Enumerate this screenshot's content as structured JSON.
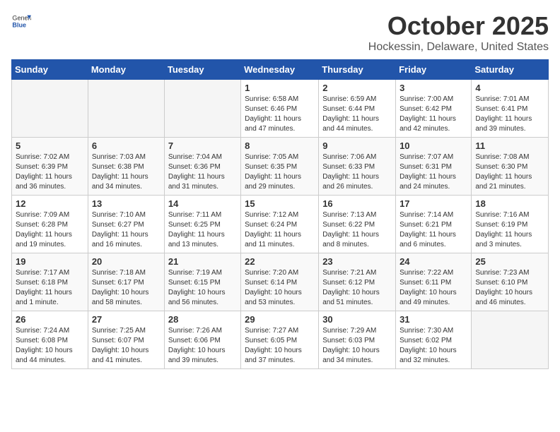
{
  "header": {
    "logo_general": "General",
    "logo_blue": "Blue",
    "month": "October 2025",
    "location": "Hockessin, Delaware, United States"
  },
  "days_of_week": [
    "Sunday",
    "Monday",
    "Tuesday",
    "Wednesday",
    "Thursday",
    "Friday",
    "Saturday"
  ],
  "weeks": [
    [
      {
        "day": "",
        "info": ""
      },
      {
        "day": "",
        "info": ""
      },
      {
        "day": "",
        "info": ""
      },
      {
        "day": "1",
        "info": "Sunrise: 6:58 AM\nSunset: 6:46 PM\nDaylight: 11 hours\nand 47 minutes."
      },
      {
        "day": "2",
        "info": "Sunrise: 6:59 AM\nSunset: 6:44 PM\nDaylight: 11 hours\nand 44 minutes."
      },
      {
        "day": "3",
        "info": "Sunrise: 7:00 AM\nSunset: 6:42 PM\nDaylight: 11 hours\nand 42 minutes."
      },
      {
        "day": "4",
        "info": "Sunrise: 7:01 AM\nSunset: 6:41 PM\nDaylight: 11 hours\nand 39 minutes."
      }
    ],
    [
      {
        "day": "5",
        "info": "Sunrise: 7:02 AM\nSunset: 6:39 PM\nDaylight: 11 hours\nand 36 minutes."
      },
      {
        "day": "6",
        "info": "Sunrise: 7:03 AM\nSunset: 6:38 PM\nDaylight: 11 hours\nand 34 minutes."
      },
      {
        "day": "7",
        "info": "Sunrise: 7:04 AM\nSunset: 6:36 PM\nDaylight: 11 hours\nand 31 minutes."
      },
      {
        "day": "8",
        "info": "Sunrise: 7:05 AM\nSunset: 6:35 PM\nDaylight: 11 hours\nand 29 minutes."
      },
      {
        "day": "9",
        "info": "Sunrise: 7:06 AM\nSunset: 6:33 PM\nDaylight: 11 hours\nand 26 minutes."
      },
      {
        "day": "10",
        "info": "Sunrise: 7:07 AM\nSunset: 6:31 PM\nDaylight: 11 hours\nand 24 minutes."
      },
      {
        "day": "11",
        "info": "Sunrise: 7:08 AM\nSunset: 6:30 PM\nDaylight: 11 hours\nand 21 minutes."
      }
    ],
    [
      {
        "day": "12",
        "info": "Sunrise: 7:09 AM\nSunset: 6:28 PM\nDaylight: 11 hours\nand 19 minutes."
      },
      {
        "day": "13",
        "info": "Sunrise: 7:10 AM\nSunset: 6:27 PM\nDaylight: 11 hours\nand 16 minutes."
      },
      {
        "day": "14",
        "info": "Sunrise: 7:11 AM\nSunset: 6:25 PM\nDaylight: 11 hours\nand 13 minutes."
      },
      {
        "day": "15",
        "info": "Sunrise: 7:12 AM\nSunset: 6:24 PM\nDaylight: 11 hours\nand 11 minutes."
      },
      {
        "day": "16",
        "info": "Sunrise: 7:13 AM\nSunset: 6:22 PM\nDaylight: 11 hours\nand 8 minutes."
      },
      {
        "day": "17",
        "info": "Sunrise: 7:14 AM\nSunset: 6:21 PM\nDaylight: 11 hours\nand 6 minutes."
      },
      {
        "day": "18",
        "info": "Sunrise: 7:16 AM\nSunset: 6:19 PM\nDaylight: 11 hours\nand 3 minutes."
      }
    ],
    [
      {
        "day": "19",
        "info": "Sunrise: 7:17 AM\nSunset: 6:18 PM\nDaylight: 11 hours\nand 1 minute."
      },
      {
        "day": "20",
        "info": "Sunrise: 7:18 AM\nSunset: 6:17 PM\nDaylight: 10 hours\nand 58 minutes."
      },
      {
        "day": "21",
        "info": "Sunrise: 7:19 AM\nSunset: 6:15 PM\nDaylight: 10 hours\nand 56 minutes."
      },
      {
        "day": "22",
        "info": "Sunrise: 7:20 AM\nSunset: 6:14 PM\nDaylight: 10 hours\nand 53 minutes."
      },
      {
        "day": "23",
        "info": "Sunrise: 7:21 AM\nSunset: 6:12 PM\nDaylight: 10 hours\nand 51 minutes."
      },
      {
        "day": "24",
        "info": "Sunrise: 7:22 AM\nSunset: 6:11 PM\nDaylight: 10 hours\nand 49 minutes."
      },
      {
        "day": "25",
        "info": "Sunrise: 7:23 AM\nSunset: 6:10 PM\nDaylight: 10 hours\nand 46 minutes."
      }
    ],
    [
      {
        "day": "26",
        "info": "Sunrise: 7:24 AM\nSunset: 6:08 PM\nDaylight: 10 hours\nand 44 minutes."
      },
      {
        "day": "27",
        "info": "Sunrise: 7:25 AM\nSunset: 6:07 PM\nDaylight: 10 hours\nand 41 minutes."
      },
      {
        "day": "28",
        "info": "Sunrise: 7:26 AM\nSunset: 6:06 PM\nDaylight: 10 hours\nand 39 minutes."
      },
      {
        "day": "29",
        "info": "Sunrise: 7:27 AM\nSunset: 6:05 PM\nDaylight: 10 hours\nand 37 minutes."
      },
      {
        "day": "30",
        "info": "Sunrise: 7:29 AM\nSunset: 6:03 PM\nDaylight: 10 hours\nand 34 minutes."
      },
      {
        "day": "31",
        "info": "Sunrise: 7:30 AM\nSunset: 6:02 PM\nDaylight: 10 hours\nand 32 minutes."
      },
      {
        "day": "",
        "info": ""
      }
    ]
  ]
}
